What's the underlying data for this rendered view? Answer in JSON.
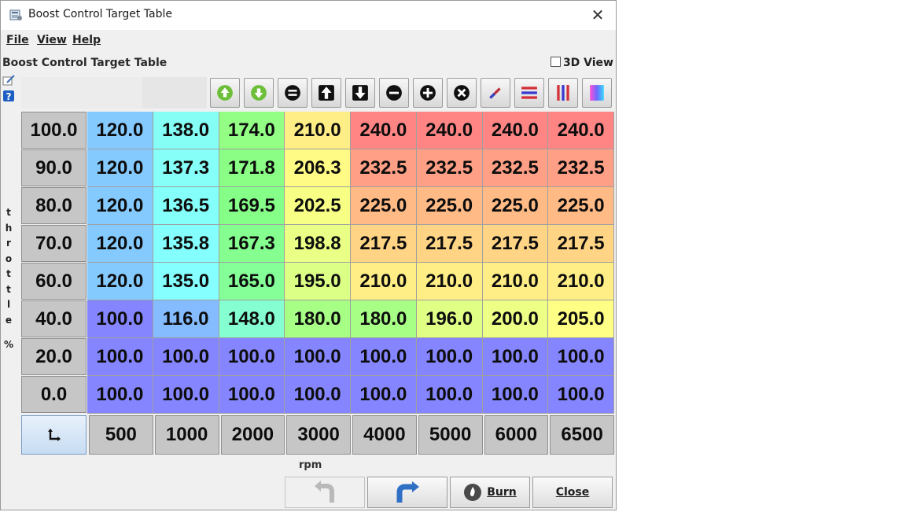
{
  "window": {
    "title": "Boost Control Target Table",
    "close_glyph": "✕"
  },
  "menu": [
    {
      "label": "File"
    },
    {
      "label": "View"
    },
    {
      "label": "Help"
    }
  ],
  "panel": {
    "title": "Boost Control Target Table",
    "view3d_label": "3D View",
    "view3d_checked": false
  },
  "toolbar": {
    "buttons": [
      {
        "icon": "arrow-up-green-icon"
      },
      {
        "icon": "arrow-down-green-icon"
      },
      {
        "icon": "equals-icon"
      },
      {
        "icon": "arrow-up-icon"
      },
      {
        "icon": "arrow-down-icon"
      },
      {
        "icon": "minus-icon"
      },
      {
        "icon": "plus-icon"
      },
      {
        "icon": "multiply-icon"
      },
      {
        "icon": "pen-icon"
      },
      {
        "icon": "horizontal-interpolate-icon"
      },
      {
        "icon": "vertical-interpolate-icon"
      },
      {
        "icon": "color-gradient-icon"
      }
    ]
  },
  "table": {
    "y_axis_label": "throttle %",
    "x_axis_label": "rpm",
    "row_headers": [
      "100.0",
      "90.0",
      "80.0",
      "70.0",
      "60.0",
      "40.0",
      "20.0",
      "0.0"
    ],
    "col_headers": [
      "500",
      "1000",
      "2000",
      "3000",
      "4000",
      "5000",
      "6000",
      "6500"
    ],
    "values": [
      [
        "120.0",
        "138.0",
        "174.0",
        "210.0",
        "240.0",
        "240.0",
        "240.0",
        "240.0"
      ],
      [
        "120.0",
        "137.3",
        "171.8",
        "206.3",
        "232.5",
        "232.5",
        "232.5",
        "232.5"
      ],
      [
        "120.0",
        "136.5",
        "169.5",
        "202.5",
        "225.0",
        "225.0",
        "225.0",
        "225.0"
      ],
      [
        "120.0",
        "135.8",
        "167.3",
        "198.8",
        "217.5",
        "217.5",
        "217.5",
        "217.5"
      ],
      [
        "120.0",
        "135.0",
        "165.0",
        "195.0",
        "210.0",
        "210.0",
        "210.0",
        "210.0"
      ],
      [
        "100.0",
        "116.0",
        "148.0",
        "180.0",
        "180.0",
        "196.0",
        "200.0",
        "205.0"
      ],
      [
        "100.0",
        "100.0",
        "100.0",
        "100.0",
        "100.0",
        "100.0",
        "100.0",
        "100.0"
      ],
      [
        "100.0",
        "100.0",
        "100.0",
        "100.0",
        "100.0",
        "100.0",
        "100.0",
        "100.0"
      ]
    ],
    "color_scale": {
      "min": 100,
      "max": 240,
      "low_color": "#8585ff",
      "high_color": "#ff8585"
    }
  },
  "buttons": {
    "undo": {
      "icon": "undo-icon",
      "enabled": false
    },
    "redo": {
      "icon": "redo-icon",
      "enabled": true
    },
    "burn": {
      "label": "Burn",
      "icon": "burn-icon"
    },
    "close": {
      "label": "Close"
    }
  }
}
